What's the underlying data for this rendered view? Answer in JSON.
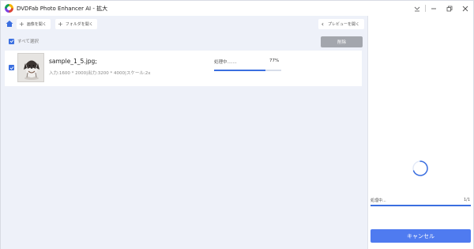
{
  "window": {
    "title": "DVDFab Photo Enhancer AI - 拡大"
  },
  "toolbar": {
    "add_image_label": "画像を開く",
    "add_folder_label": "フォルダを開く",
    "preview_label": "プレビューを開く"
  },
  "selection": {
    "select_all_label": "すべて選択",
    "select_all_checked": true,
    "delete_label": "削除"
  },
  "items": [
    {
      "filename": "sample_1_5.jpg;",
      "meta": "入力:1600 * 2000|出力:3200 * 4000|スケール:2x",
      "status": "処理中.......",
      "percent_label": "77%",
      "progress": 0.77,
      "checked": true
    }
  ],
  "summary": {
    "status": "処理中...",
    "count": "1/1",
    "progress": 1.0
  },
  "actions": {
    "cancel_label": "キャンセル"
  },
  "colors": {
    "accent": "#3b6fe0",
    "button_primary": "#4f7bf0",
    "button_disabled": "#a3a6ad",
    "panel_bg": "#eef1f9"
  }
}
